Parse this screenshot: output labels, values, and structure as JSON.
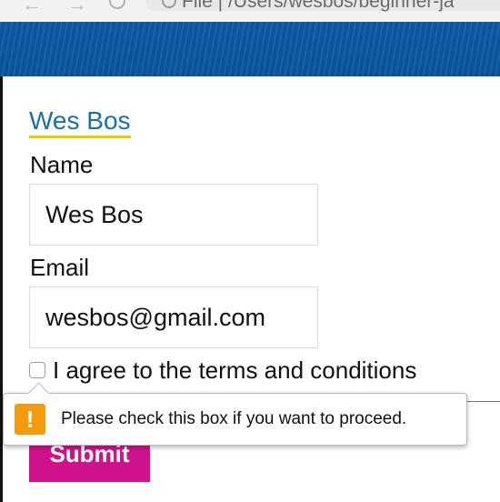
{
  "browser": {
    "back_icon": "arrow-left-icon",
    "forward_icon": "arrow-right-icon",
    "address_text": "File | /Users/wesbos/beginner-ja"
  },
  "site": {
    "title_link": "Wes Bos",
    "banner_color": "#0b5aa6",
    "link_color": "#1a6fb0",
    "underline_color": "#f6c300"
  },
  "form": {
    "name_label": "Name",
    "name_value": "Wes Bos",
    "email_label": "Email",
    "email_value": "wesbos@gmail.com",
    "agree_label": "I agree to the terms and conditions",
    "agree_checked": false,
    "submit_label": "Submit",
    "submit_color": "#d0118c"
  },
  "validation": {
    "message": "Please check this box if you want to proceed.",
    "icon": "warning-icon",
    "icon_glyph": "!",
    "icon_color": "#f29b0c"
  }
}
